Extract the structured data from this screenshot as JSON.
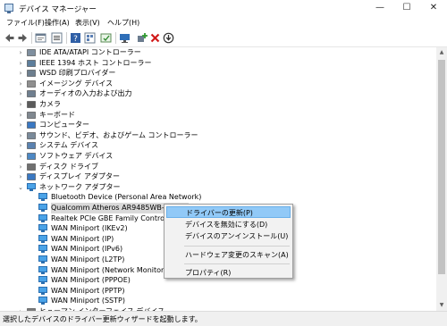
{
  "window": {
    "title": "デバイス マネージャー"
  },
  "window_buttons": {
    "minimize": "—",
    "maximize": "☐",
    "close": "✕"
  },
  "menu": [
    "ファイル(F)",
    "操作(A)",
    "表示(V)",
    "ヘルプ(H)"
  ],
  "toolbar_icons": [
    "back-arrow-icon",
    "forward-arrow-icon",
    "properties-icon",
    "list-icon",
    "help-icon",
    "view-icon",
    "refresh-icon",
    "computer-scan-icon",
    "add-driver-icon",
    "uninstall-icon",
    "download-icon"
  ],
  "tree": {
    "rows": [
      {
        "label": "IDE ATA/ATAPI コントローラー",
        "icon": "ide-controller-icon",
        "expanded": false,
        "level": 1
      },
      {
        "label": "IEEE 1394 ホスト コントローラー",
        "icon": "ieee1394-icon",
        "expanded": false,
        "level": 1
      },
      {
        "label": "WSD 印刷プロバイダー",
        "icon": "printer-icon",
        "expanded": false,
        "level": 1
      },
      {
        "label": "イメージング デバイス",
        "icon": "imaging-device-icon",
        "expanded": false,
        "level": 1
      },
      {
        "label": "オーディオの入力および出力",
        "icon": "audio-icon",
        "expanded": false,
        "level": 1
      },
      {
        "label": "カメラ",
        "icon": "camera-icon",
        "expanded": false,
        "level": 1
      },
      {
        "label": "キーボード",
        "icon": "keyboard-icon",
        "expanded": false,
        "level": 1
      },
      {
        "label": "コンピューター",
        "icon": "computer-icon",
        "expanded": false,
        "level": 1
      },
      {
        "label": "サウンド、ビデオ、およびゲーム コントローラー",
        "icon": "sound-icon",
        "expanded": false,
        "level": 1
      },
      {
        "label": "システム デバイス",
        "icon": "system-device-icon",
        "expanded": false,
        "level": 1
      },
      {
        "label": "ソフトウェア デバイス",
        "icon": "software-device-icon",
        "expanded": false,
        "level": 1
      },
      {
        "label": "ディスク ドライブ",
        "icon": "disk-drive-icon",
        "expanded": false,
        "level": 1
      },
      {
        "label": "ディスプレイ アダプター",
        "icon": "display-adapter-icon",
        "expanded": false,
        "level": 1
      },
      {
        "label": "ネットワーク アダプター",
        "icon": "network-adapter-icon",
        "expanded": true,
        "level": 1
      },
      {
        "label": "Bluetooth Device (Personal Area Network)",
        "icon": "network-adapter-icon",
        "level": 2
      },
      {
        "label": "Qualcomm Atheros AR9485WB-EG Wir",
        "icon": "network-adapter-icon",
        "level": 2,
        "selected": true
      },
      {
        "label": "Realtek PCIe GBE Family Controller",
        "icon": "network-adapter-icon",
        "level": 2
      },
      {
        "label": "WAN Miniport (IKEv2)",
        "icon": "network-adapter-icon",
        "level": 2
      },
      {
        "label": "WAN Miniport (IP)",
        "icon": "network-adapter-icon",
        "level": 2
      },
      {
        "label": "WAN Miniport (IPv6)",
        "icon": "network-adapter-icon",
        "level": 2
      },
      {
        "label": "WAN Miniport (L2TP)",
        "icon": "network-adapter-icon",
        "level": 2
      },
      {
        "label": "WAN Miniport (Network Monitor)",
        "icon": "network-adapter-icon",
        "level": 2
      },
      {
        "label": "WAN Miniport (PPPOE)",
        "icon": "network-adapter-icon",
        "level": 2
      },
      {
        "label": "WAN Miniport (PPTP)",
        "icon": "network-adapter-icon",
        "level": 2
      },
      {
        "label": "WAN Miniport (SSTP)",
        "icon": "network-adapter-icon",
        "level": 2
      },
      {
        "label": "ヒューマン インターフェイス デバイス",
        "icon": "hid-icon",
        "expanded": false,
        "level": 1
      }
    ]
  },
  "context_menu": {
    "items": [
      {
        "label": "ドライバーの更新(P)",
        "highlighted": true
      },
      {
        "label": "デバイスを無効にする(D)"
      },
      {
        "label": "デバイスのアンインストール(U)"
      },
      {
        "separator": true
      },
      {
        "label": "ハードウェア変更のスキャン(A)"
      },
      {
        "separator": true
      },
      {
        "label": "プロパティ(R)"
      }
    ]
  },
  "status": {
    "text": "選択したデバイスのドライバー更新ウィザードを起動します。"
  },
  "colors": {
    "highlight": "#91c9f7",
    "selected_row": "#d9d9d9",
    "menu_bg": "#f2f2f2"
  }
}
